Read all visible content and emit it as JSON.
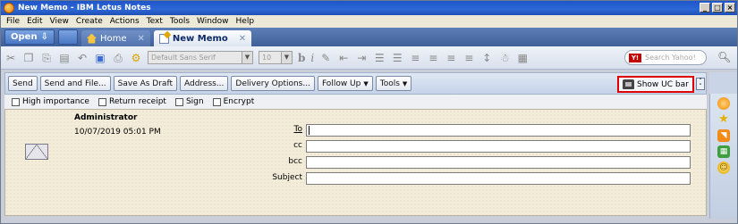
{
  "window": {
    "title": "New Memo - IBM Lotus Notes",
    "controls": [
      "_",
      "□",
      "×"
    ]
  },
  "menu": [
    "File",
    "Edit",
    "View",
    "Create",
    "Actions",
    "Text",
    "Tools",
    "Window",
    "Help"
  ],
  "tabs": {
    "open_label": "Open",
    "items": [
      {
        "label": "Home",
        "icon": "home-icon"
      },
      {
        "label": "New Memo",
        "icon": "memo-icon"
      }
    ]
  },
  "toolbar": {
    "font_name": "Default Sans Serif",
    "font_size": "10",
    "bold": "b",
    "italic": "i",
    "search_placeholder": "Search Yahoo!",
    "search_provider": "Y!"
  },
  "actions": {
    "send": "Send",
    "send_and_file": "Send and File...",
    "save_as_draft": "Save As Draft",
    "address": "Address...",
    "delivery_options": "Delivery Options...",
    "follow_up": "Follow Up",
    "tools": "Tools",
    "show_uc_bar": "Show UC bar"
  },
  "options": {
    "high_importance": "High importance",
    "return_receipt": "Return receipt",
    "sign": "Sign",
    "encrypt": "Encrypt"
  },
  "header": {
    "sender": "Administrator",
    "date": "10/07/2019 05:01 PM",
    "to_label": "To",
    "cc_label": "cc",
    "bcc_label": "bcc",
    "subject_label": "Subject",
    "to_value": "",
    "cc_value": "",
    "bcc_value": "",
    "subject_value": ""
  },
  "colors": {
    "title_bar": "#2d68d6",
    "tab_bar": "#3f5f98",
    "highlight_box": "#e00000",
    "memo_background": "#f3ecd8"
  }
}
